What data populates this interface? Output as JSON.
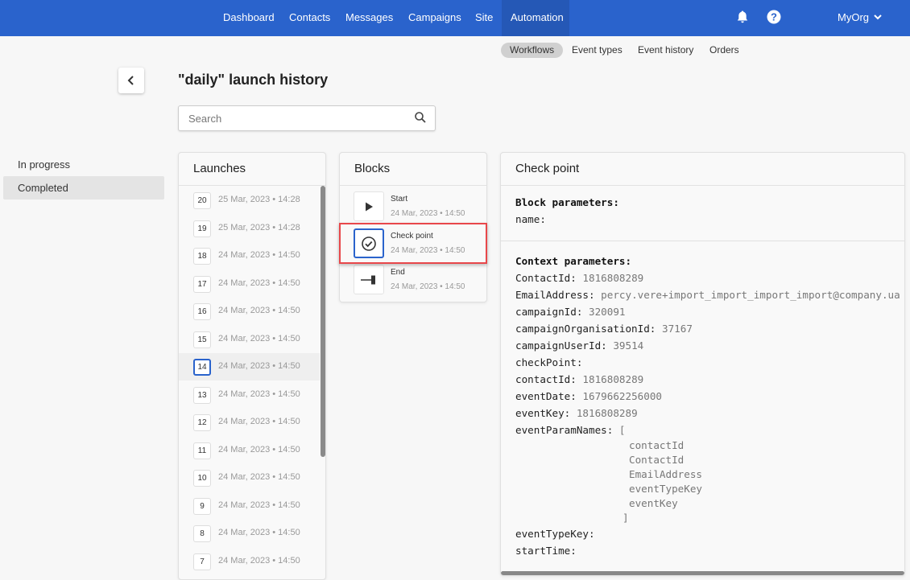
{
  "nav": {
    "items": [
      "Dashboard",
      "Contacts",
      "Messages",
      "Campaigns",
      "Site",
      "Automation"
    ],
    "active": "Automation",
    "org": "MyOrg",
    "accent": "#2a63cc"
  },
  "subnav": {
    "items": [
      "Workflows",
      "Event types",
      "Event history",
      "Orders"
    ],
    "active": "Workflows"
  },
  "page": {
    "title": "\"daily\" launch history"
  },
  "search": {
    "placeholder": "Search"
  },
  "sidebar": {
    "items": [
      "In progress",
      "Completed"
    ],
    "active": "Completed"
  },
  "launches": {
    "title": "Launches",
    "selected": "14",
    "items": [
      {
        "num": "20",
        "date": "25 Mar, 2023 • 14:28"
      },
      {
        "num": "19",
        "date": "25 Mar, 2023 • 14:28"
      },
      {
        "num": "18",
        "date": "24 Mar, 2023 • 14:50"
      },
      {
        "num": "17",
        "date": "24 Mar, 2023 • 14:50"
      },
      {
        "num": "16",
        "date": "24 Mar, 2023 • 14:50"
      },
      {
        "num": "15",
        "date": "24 Mar, 2023 • 14:50"
      },
      {
        "num": "14",
        "date": "24 Mar, 2023 • 14:50"
      },
      {
        "num": "13",
        "date": "24 Mar, 2023 • 14:50"
      },
      {
        "num": "12",
        "date": "24 Mar, 2023 • 14:50"
      },
      {
        "num": "11",
        "date": "24 Mar, 2023 • 14:50"
      },
      {
        "num": "10",
        "date": "24 Mar, 2023 • 14:50"
      },
      {
        "num": "9",
        "date": "24 Mar, 2023 • 14:50"
      },
      {
        "num": "8",
        "date": "24 Mar, 2023 • 14:50"
      },
      {
        "num": "7",
        "date": "24 Mar, 2023 • 14:50"
      }
    ]
  },
  "blocks": {
    "title": "Blocks",
    "items": [
      {
        "name": "Start",
        "date": "24 Mar, 2023 • 14:50",
        "icon": "play-icon"
      },
      {
        "name": "Check point",
        "date": "24 Mar, 2023 • 14:50",
        "icon": "check-circle-icon"
      },
      {
        "name": "End",
        "date": "24 Mar, 2023 • 14:50",
        "icon": "end-icon"
      }
    ],
    "selected": "Check point"
  },
  "details": {
    "title": "Check point",
    "block_heading": "Block parameters:",
    "block_params": [
      {
        "key": "name:",
        "value": ""
      }
    ],
    "context_heading": "Context parameters:",
    "context_params": [
      {
        "key": "ContactId:",
        "value": "1816808289"
      },
      {
        "key": "EmailAddress:",
        "value": "percy.vere+import_import_import_import@company.ua"
      },
      {
        "key": "campaignId:",
        "value": "320091"
      },
      {
        "key": "campaignOrganisationId:",
        "value": "37167"
      },
      {
        "key": "campaignUserId:",
        "value": "39514"
      },
      {
        "key": "checkPoint:",
        "value": ""
      },
      {
        "key": "contactId:",
        "value": "1816808289"
      },
      {
        "key": "eventDate:",
        "value": "1679662256000"
      },
      {
        "key": "eventKey:",
        "value": "1816808289"
      }
    ],
    "array_key": "eventParamNames:",
    "array_open": "[",
    "array_items": [
      "contactId",
      "ContactId",
      "EmailAddress",
      "eventTypeKey",
      "eventKey"
    ],
    "array_close": "]",
    "after_params": [
      {
        "key": "eventTypeKey:",
        "value": ""
      },
      {
        "key": "startTime:",
        "value": ""
      }
    ]
  }
}
